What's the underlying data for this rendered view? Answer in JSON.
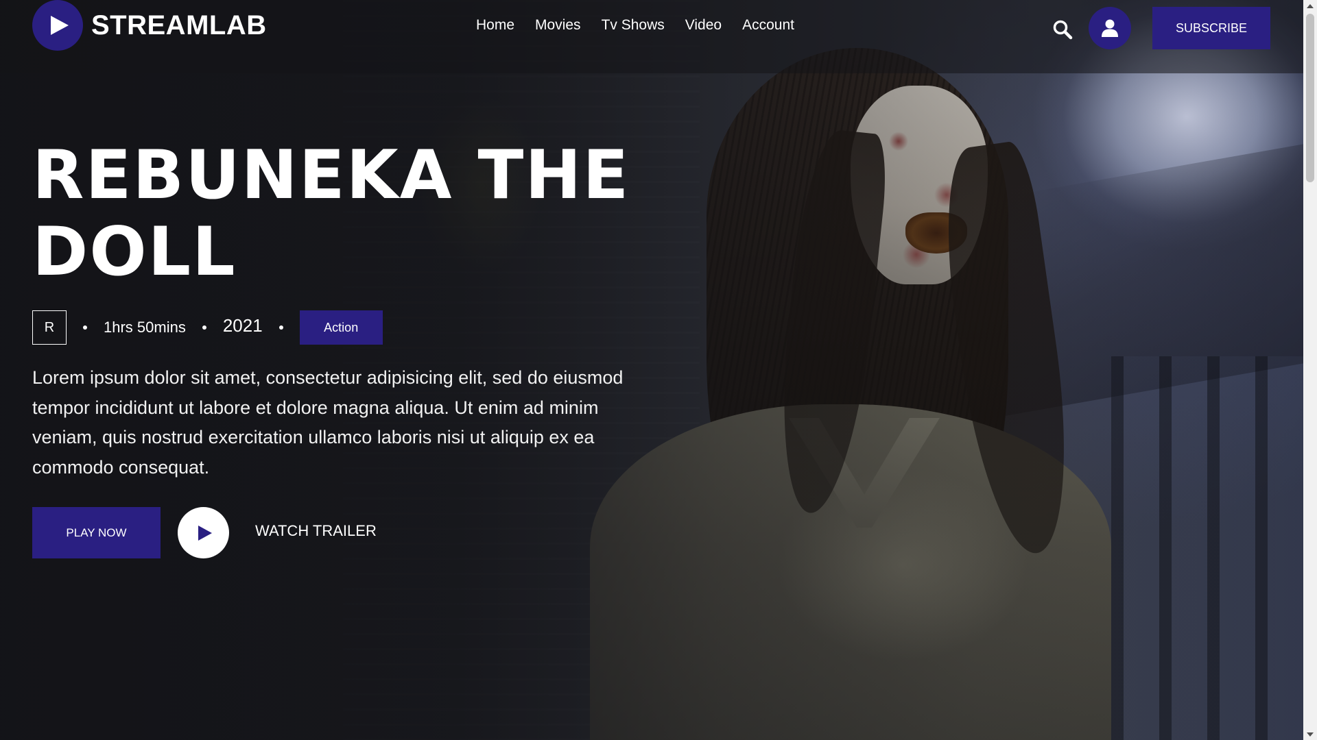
{
  "brand": {
    "name": "STREAMLAB",
    "accent": "#2a1f82"
  },
  "nav": {
    "items": [
      {
        "label": "Home"
      },
      {
        "label": "Movies"
      },
      {
        "label": "Tv Shows"
      },
      {
        "label": "Video"
      },
      {
        "label": "Account"
      }
    ]
  },
  "header": {
    "search_icon": "search-icon",
    "user_icon": "user-icon",
    "subscribe_label": "SUBSCRIBE"
  },
  "hero": {
    "title_line1": "REBUNEKA THE",
    "title_line2": "DOLL",
    "rating": "R",
    "duration": "1hrs 50mins",
    "year": "2021",
    "genre": "Action",
    "description": "Lorem ipsum dolor sit amet, consectetur adipisicing elit, sed do eiusmod tempor incididunt ut labore et dolore magna aliqua. Ut enim ad minim veniam, quis nostrud exercitation ullamco laboris nisi ut aliquip ex ea commodo consequat.",
    "play_label": "PLAY NOW",
    "trailer_label": "WATCH TRAILER"
  }
}
